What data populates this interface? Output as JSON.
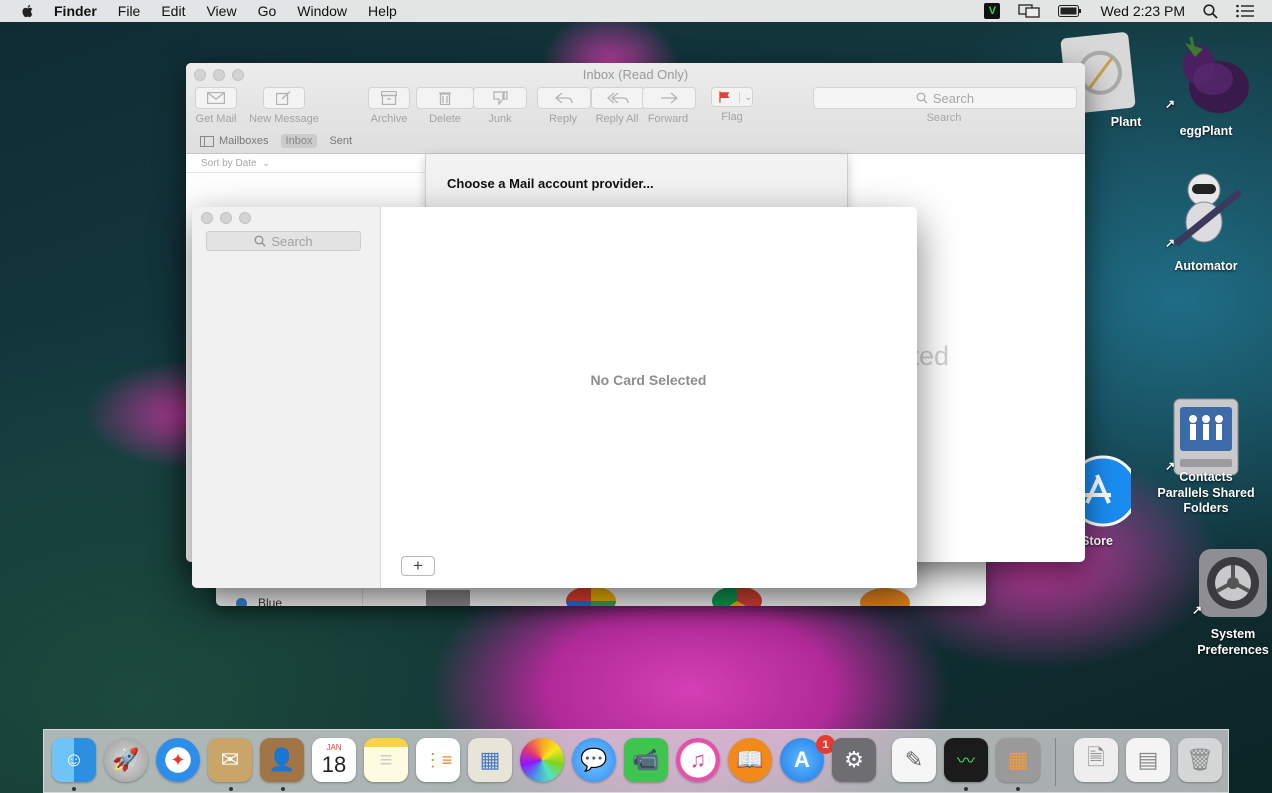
{
  "menubar": {
    "app_name": "Finder",
    "items": [
      "File",
      "Edit",
      "View",
      "Go",
      "Window",
      "Help"
    ],
    "clock": "Wed 2:23 PM",
    "vc_label": "V"
  },
  "desktop_icons": {
    "plant_partial": "Plant",
    "eggplant": "eggPlant",
    "automator": "Automator",
    "contacts_shared": "Contacts\nParallels Shared\nFolders",
    "store_partial": "Store",
    "system_prefs": "System\nPreferences"
  },
  "mail": {
    "title": "Inbox (Read Only)",
    "toolbar": {
      "get_mail": "Get Mail",
      "new_message": "New Message",
      "archive": "Archive",
      "delete": "Delete",
      "junk": "Junk",
      "reply": "Reply",
      "reply_all": "Reply All",
      "forward": "Forward",
      "flag": "Flag",
      "search_placeholder": "Search",
      "search_label": "Search"
    },
    "favorites": {
      "mailboxes": "Mailboxes",
      "inbox": "Inbox",
      "sent": "Sent"
    },
    "sort": "Sort by Date",
    "watermark": "cted"
  },
  "sheet": {
    "title": "Choose a Mail account provider..."
  },
  "back_window": {
    "label": "Blue"
  },
  "contacts": {
    "search_placeholder": "Search",
    "no_card": "No Card Selected",
    "add_label": "+"
  },
  "dock": {
    "calendar_month": "JAN",
    "calendar_day": "18",
    "appstore_badge": "1"
  },
  "colors": {
    "accent_blue": "#3d86d6",
    "flag_red": "#e0443a",
    "badge_red": "#e53b30"
  }
}
